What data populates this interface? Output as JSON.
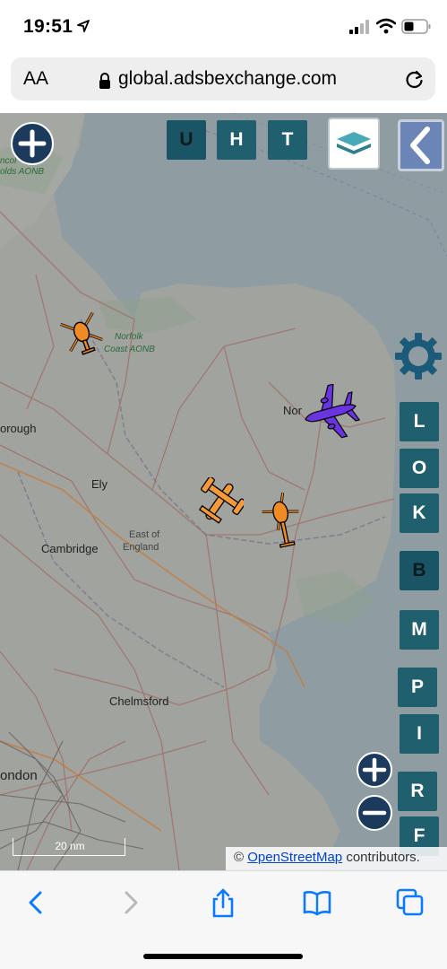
{
  "status": {
    "time": "19:51"
  },
  "browser": {
    "text_size_label": "AA",
    "url": "global.adsbexchange.com"
  },
  "map": {
    "top_buttons": [
      "U",
      "H",
      "T"
    ],
    "side_buttons": [
      "L",
      "O",
      "K",
      "B",
      "M",
      "P",
      "I",
      "R",
      "F"
    ],
    "place_labels": {
      "lincs_aonb": "olds AONB",
      "lincs_aonb2": "ncol",
      "norfolk_aonb": "Norfolk",
      "norfolk_aonb2": "Coast AONB",
      "peterborough": "orough",
      "norwich": "Nor",
      "ely": "Ely",
      "east_of_england": "East of",
      "east_of_england2": "England",
      "cambridge": "Cambridge",
      "chelmsford": "Chelmsford",
      "london": "ondon"
    },
    "scale_label": "20 nm",
    "attribution_prefix": "©",
    "attribution_link": "OpenStreetMap",
    "attribution_suffix": "contributors.",
    "aircraft": [
      {
        "kind": "helicopter",
        "color": "#f08a24"
      },
      {
        "kind": "jet-transport",
        "color": "#6a34e0"
      },
      {
        "kind": "tiltrotor",
        "color": "#f59a38"
      },
      {
        "kind": "helicopter",
        "color": "#f08a24"
      }
    ],
    "colors": {
      "button_teal": "#1f5f6e",
      "zoom_navy": "#1b3a5c",
      "back_blue": "#6b86b6"
    }
  },
  "icons": {
    "toolbar": [
      "back-icon",
      "forward-icon",
      "share-icon",
      "bookmarks-icon",
      "tabs-icon"
    ]
  }
}
